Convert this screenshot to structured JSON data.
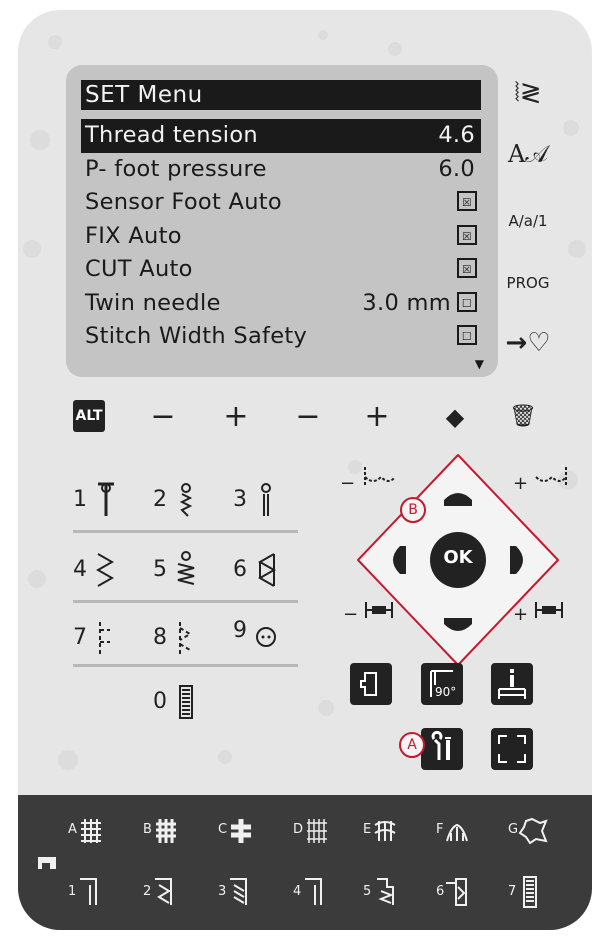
{
  "lcd": {
    "title": "SET Menu",
    "items": [
      {
        "label": "Thread tension",
        "value": "4.6",
        "selected": true
      },
      {
        "label": "P- foot pressure",
        "value": "6.0"
      },
      {
        "label": "Sensor Foot Auto",
        "check": "☒"
      },
      {
        "label": "FIX Auto",
        "check": "☒"
      },
      {
        "label": "CUT Auto",
        "check": "☒"
      },
      {
        "label": "Twin needle",
        "value": "3.0 mm",
        "check": "☐"
      },
      {
        "label": "Stitch Width Safety",
        "check": "☐"
      }
    ],
    "scroll_arrow": "▼"
  },
  "side_buttons": {
    "tie_off": "⦚≷",
    "font": "A𝒜",
    "case": "A/a/1",
    "prog": "PROG",
    "favorite": "→♡"
  },
  "toolbar": {
    "alt": "ALT",
    "minus1": "−",
    "plus1": "+",
    "minus2": "−",
    "plus2": "+",
    "mirror": "◆",
    "delete": "🗑"
  },
  "stitches": {
    "s1": "1",
    "s2": "2",
    "s3": "3",
    "s4": "4",
    "s5": "5",
    "s6": "6",
    "s7": "7",
    "s8": "8",
    "s9": "9",
    "s0": "0"
  },
  "nav": {
    "ok": "OK",
    "label_b": "B",
    "label_a": "A",
    "minus": "−",
    "plus": "+",
    "angle": "90°"
  },
  "bottom": {
    "letters": [
      "A",
      "B",
      "C",
      "D",
      "E",
      "F",
      "G"
    ],
    "numbers": [
      "1",
      "2",
      "3",
      "4",
      "5",
      "6",
      "7"
    ]
  },
  "colors": {
    "accent": "#c5192d",
    "panel": "#e6e6e6",
    "lcd": "#c4c4c4",
    "dark_strip": "#3b3b3b"
  }
}
